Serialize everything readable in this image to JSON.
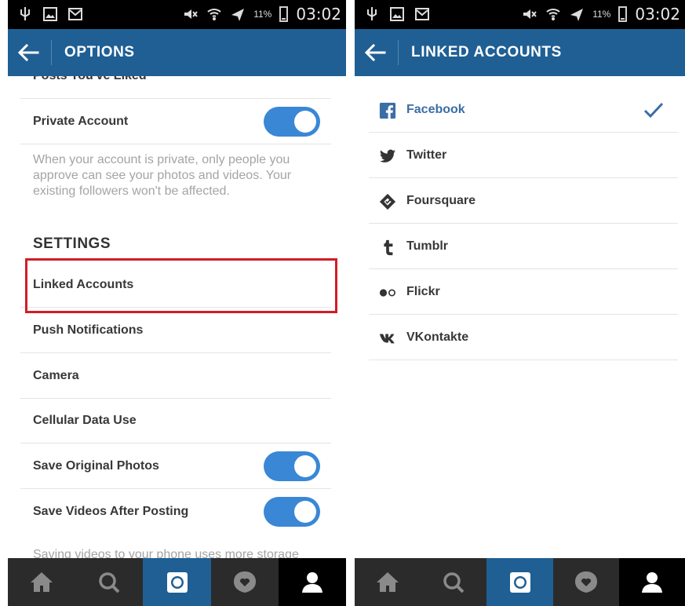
{
  "status_bar": {
    "battery_percent": "11%",
    "time": "03:02",
    "icons": [
      "usb-icon",
      "gallery-icon",
      "mail-icon",
      "mute-icon",
      "wifi-icon",
      "airplane-icon",
      "battery-icon"
    ]
  },
  "options_screen": {
    "title": "OPTIONS",
    "partial_top_item": "Posts You've Liked",
    "private_account": {
      "label": "Private Account",
      "enabled": true
    },
    "private_helper": "When your account is private, only people you approve can see your photos and videos. Your existing followers won't be affected.",
    "settings_title": "SETTINGS",
    "items": [
      {
        "label": "Linked Accounts",
        "highlighted": true
      },
      {
        "label": "Push Notifications"
      },
      {
        "label": "Camera"
      },
      {
        "label": "Cellular Data Use"
      },
      {
        "label": "Save Original Photos",
        "toggle": true,
        "enabled": true
      },
      {
        "label": "Save Videos After Posting",
        "toggle": true,
        "enabled": true
      }
    ],
    "partial_bottom_helper": "Saving videos to your phone uses more storage"
  },
  "linked_screen": {
    "title": "LINKED ACCOUNTS",
    "accounts": [
      {
        "label": "Facebook",
        "icon": "facebook-icon",
        "linked": true
      },
      {
        "label": "Twitter",
        "icon": "twitter-icon",
        "linked": false
      },
      {
        "label": "Foursquare",
        "icon": "foursquare-icon",
        "linked": false
      },
      {
        "label": "Tumblr",
        "icon": "tumblr-icon",
        "linked": false
      },
      {
        "label": "Flickr",
        "icon": "flickr-icon",
        "linked": false
      },
      {
        "label": "VKontakte",
        "icon": "vkontakte-icon",
        "linked": false
      }
    ]
  },
  "tab_bar": {
    "tabs": [
      "home-icon",
      "search-icon",
      "camera-icon",
      "activity-icon",
      "profile-icon"
    ],
    "active_tab": "camera-icon"
  },
  "colors": {
    "header": "#1f5f94",
    "toggle_on": "#3a87d6",
    "highlight_box": "#d21d27",
    "facebook_blue": "#3b6ea5",
    "tab_bar": "#2b2b2b"
  }
}
